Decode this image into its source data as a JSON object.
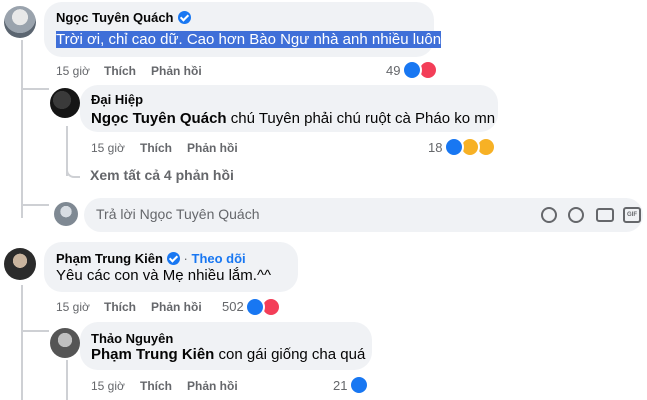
{
  "comment1": {
    "author": "Ngọc Tuyên Quách",
    "text": "Trời ơi, chỉ cao dữ. Cao hơn Bào Ngư nhà anh nhiều luôn",
    "time": "15 giờ",
    "like_label": "Thích",
    "reply_label": "Phản hồi",
    "reaction_count": "49",
    "reply": {
      "author": "Đại Hiệp",
      "mention": "Ngọc Tuyên Quách",
      "text": " chú Tuyên phải chú ruột cà Pháo ko mn",
      "time": "15 giờ",
      "like_label": "Thích",
      "reply_label": "Phản hồi",
      "reaction_count": "18"
    },
    "view_more": "Xem tất cả 4 phản hồi",
    "reply_placeholder": "Trả lời Ngọc Tuyên Quách"
  },
  "comment2": {
    "author": "Phạm Trung Kiên",
    "follow_label": "Theo dõi",
    "text": "Yêu các con và Mẹ nhiều lắm.^^",
    "time": "15 giờ",
    "like_label": "Thích",
    "reply_label": "Phản hồi",
    "reaction_count": "502",
    "reply": {
      "author": "Thảo Nguyên",
      "mention": "Phạm Trung Kiên",
      "text": " con gái giống cha quá",
      "time": "15 giờ",
      "like_label": "Thích",
      "reply_label": "Phản hồi",
      "reaction_count": "21"
    }
  },
  "colors": {
    "like": "#1877f2",
    "love": "#f33e58",
    "haha": "#f7b125",
    "link": "#1877f2"
  },
  "icons": [
    "like-icon",
    "love-icon",
    "haha-icon",
    "care-icon",
    "emoji-icon",
    "sticker-icon",
    "camera-icon",
    "gif-icon",
    "verified-icon",
    "more-icon"
  ]
}
